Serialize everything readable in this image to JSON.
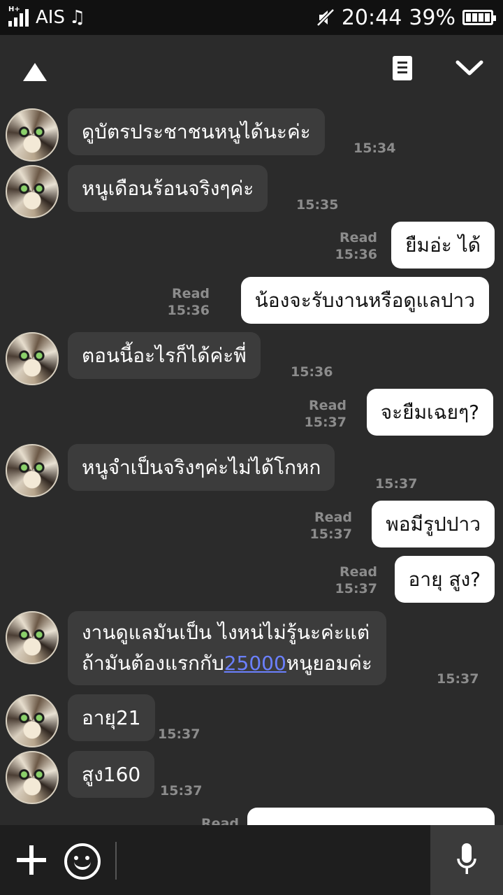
{
  "status_bar": {
    "network": "H+",
    "carrier": "AIS",
    "note_icon": "music-note-icon",
    "mute_icon": "mute-icon",
    "time": "20:44",
    "battery": "39%"
  },
  "header": {
    "up_icon": "triangle-up-icon",
    "notes_icon": "notes-icon",
    "down_icon": "chevron-down-icon"
  },
  "messages": [
    {
      "dir": "in",
      "text": "ดูบัตรประชาชนหนูได้นะค่ะ",
      "time": "15:34"
    },
    {
      "dir": "in",
      "text": "หนูเดือนร้อนจริงๆค่ะ",
      "time": "15:35"
    },
    {
      "dir": "out",
      "text": "ยืมอ่ะ ได้",
      "read": "Read",
      "time": "15:36"
    },
    {
      "dir": "out",
      "text": "น้องจะรับงานหรือดูแลปาว",
      "read": "Read",
      "time": "15:36"
    },
    {
      "dir": "in",
      "text": "ตอนนี้อะไรก็ได้ค่ะพี่",
      "time": "15:36"
    },
    {
      "dir": "out",
      "text": "จะยืมเฉยๆ?",
      "read": "Read",
      "time": "15:37"
    },
    {
      "dir": "in",
      "text": "หนูจำเป็นจริงๆค่ะไม่ได้โกหก",
      "time": "15:37"
    },
    {
      "dir": "out",
      "text": "พอมีรูปปาว",
      "read": "Read",
      "time": "15:37"
    },
    {
      "dir": "out",
      "text": "อายุ สูง?",
      "read": "Read",
      "time": "15:37"
    },
    {
      "dir": "in",
      "line1": "งานดูแลมันเป็น ไงหน่ไม่รู้นะค่ะแต่",
      "line2_pre": "ถ้ามันต้องแรกกับ",
      "line2_link": "25000",
      "line2_post": "หนูยอมค่ะ",
      "time": "15:37"
    },
    {
      "dir": "in",
      "text": "อายุ21",
      "time": "15:37"
    },
    {
      "dir": "in",
      "text": "สูง160",
      "time": "15:37"
    },
    {
      "dir": "out",
      "text": "",
      "read": "Read",
      "time": ""
    }
  ],
  "input": {
    "plus_icon": "plus-icon",
    "emoji_icon": "emoji-icon",
    "placeholder": "",
    "mic_icon": "microphone-icon"
  }
}
